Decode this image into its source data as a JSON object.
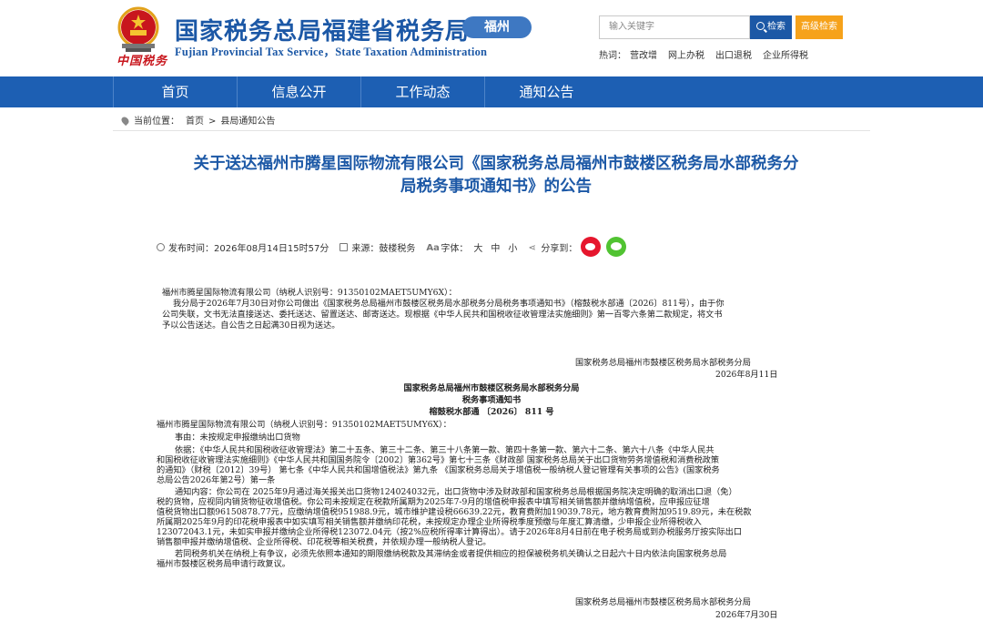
{
  "header": {
    "site_title": "国家税务总局福建省税务局",
    "site_subtitle": "Fujian Provincial Tax Service，State Taxation Administration",
    "region_badge": "福州",
    "logo_text": "中国税务",
    "search": {
      "placeholder": "输入关键字",
      "button": "检索",
      "advanced": "高级检索"
    },
    "hotwords": {
      "label": "热词：",
      "items": [
        "营改增",
        "网上办税",
        "出口退税",
        "企业所得税"
      ]
    }
  },
  "nav": {
    "items": [
      "首页",
      "信息公开",
      "工作动态",
      "通知公告"
    ]
  },
  "breadcrumb": {
    "label": "当前位置：",
    "items": [
      "首页",
      "县局通知公告"
    ],
    "separator": ">"
  },
  "article": {
    "title_line1": "关于送达福州市腾星国际物流有限公司《国家税务总局福州市鼓楼区税务局水部税务分",
    "title_line2": "局税务事项通知书》的公告",
    "meta": {
      "publish_label": "发布时间：",
      "publish_time": "2026年08月14日15时57分",
      "source_label": "来源：",
      "source": "鼓楼税务",
      "font_label": "字体：",
      "font_sizes": [
        "大",
        "中",
        "小"
      ],
      "share_label": "分享到："
    }
  },
  "notice": {
    "addressee": "福州市腾星国际物流有限公司（纳税人识别号：91350102MAET5UMY6X）：",
    "body_lines": [
      "我分局于2026年7月30日对你公司做出《国家税务总局福州市鼓楼区税务局水部税务分局税务事项通知书》（榕鼓税水部通〔2026〕811号），由于你",
      "公司失联，文书无法直接送达、委托送达、留置送达、邮寄送达。现根据《中华人民共和国税收征收管理法实施细则》第一百零六条第二款规定，将文书",
      "予以公告送达。自公告之日起满30日视为送达。"
    ],
    "signature": "国家税务总局福州市鼓楼区税务局水部税务分局",
    "date": "2026年8月11日"
  },
  "attached": {
    "heading1": "国家税务总局福州市鼓楼区税务局水部税务分局",
    "heading2": "税务事项通知书",
    "doc_number": "榕鼓税水部通 〔2026〕 811 号",
    "addressee": "福州市腾星国际物流有限公司（纳税人识别号：91350102MAET5UMY6X）：",
    "matter": "事由：未按规定申报缴纳出口货物",
    "basis_lines": [
      "依据：《中华人民共和国税收征收管理法》第二十五条、第三十二条、第三十八条第一款、第四十条第一款、第六十二条、第六十八条《中华人民共",
      "和国税收征收管理法实施细则》《中华人民共和国国务院令〔2002〕第362号》第七十三条《财政部 国家税务总局关于出口货物劳务增值税和消费税政策",
      "的通知》（财税〔2012〕39号）  第七条《中华人民共和国增值税法》第九条 《国家税务总局关于增值税一般纳税人登记管理有关事项的公告》(国家税务",
      "总局公告2026年第2号）第一条"
    ],
    "content_lines": [
      "通知内容：你公司在 2025年9月通过海关报关出口货物124024032元，出口货物中涉及财政部和国家税务总局根据国务院决定明确的取消出口退（免）",
      "税的货物，应视同内销货物征收增值税。你公司未按规定在税款所属期为2025年7-9月的增值税申报表中填写相关销售额并缴纳增值税，应申报应征增",
      "值税货物出口额96150878.77元，应缴纳增值税951988.9元，城市维护建设税66639.22元，教育费附加19039.78元，地方教育费附加9519.89元，未在税款",
      "所属期2025年9月的印花税申报表中如实填写相关销售额并缴纳印花税，未按规定办理企业所得税季度预缴与年度汇算清缴，少申报企业所得税收入",
      "123072043.1元，未如实申报并缴纳企业所得税123072.04元（按2%应税所得率计算得出）。请于2026年8月4日前在电子税务局或到办税服务厅按实际出口",
      "销售额申报并缴纳增值税、企业所得税、印花税等相关税费，并依规办理一般纳税人登记。"
    ],
    "review_lines": [
      "若同税务机关在纳税上有争议，必须先依照本通知的期限缴纳税款及其滞纳金或者提供相应的担保被税务机关确认之日起六十日内依法向国家税务总局",
      "福州市鼓楼区税务局申请行政复议。"
    ],
    "signature": "国家税务总局福州市鼓楼区税务局水部税务分局",
    "date": "2026年7月30日"
  }
}
